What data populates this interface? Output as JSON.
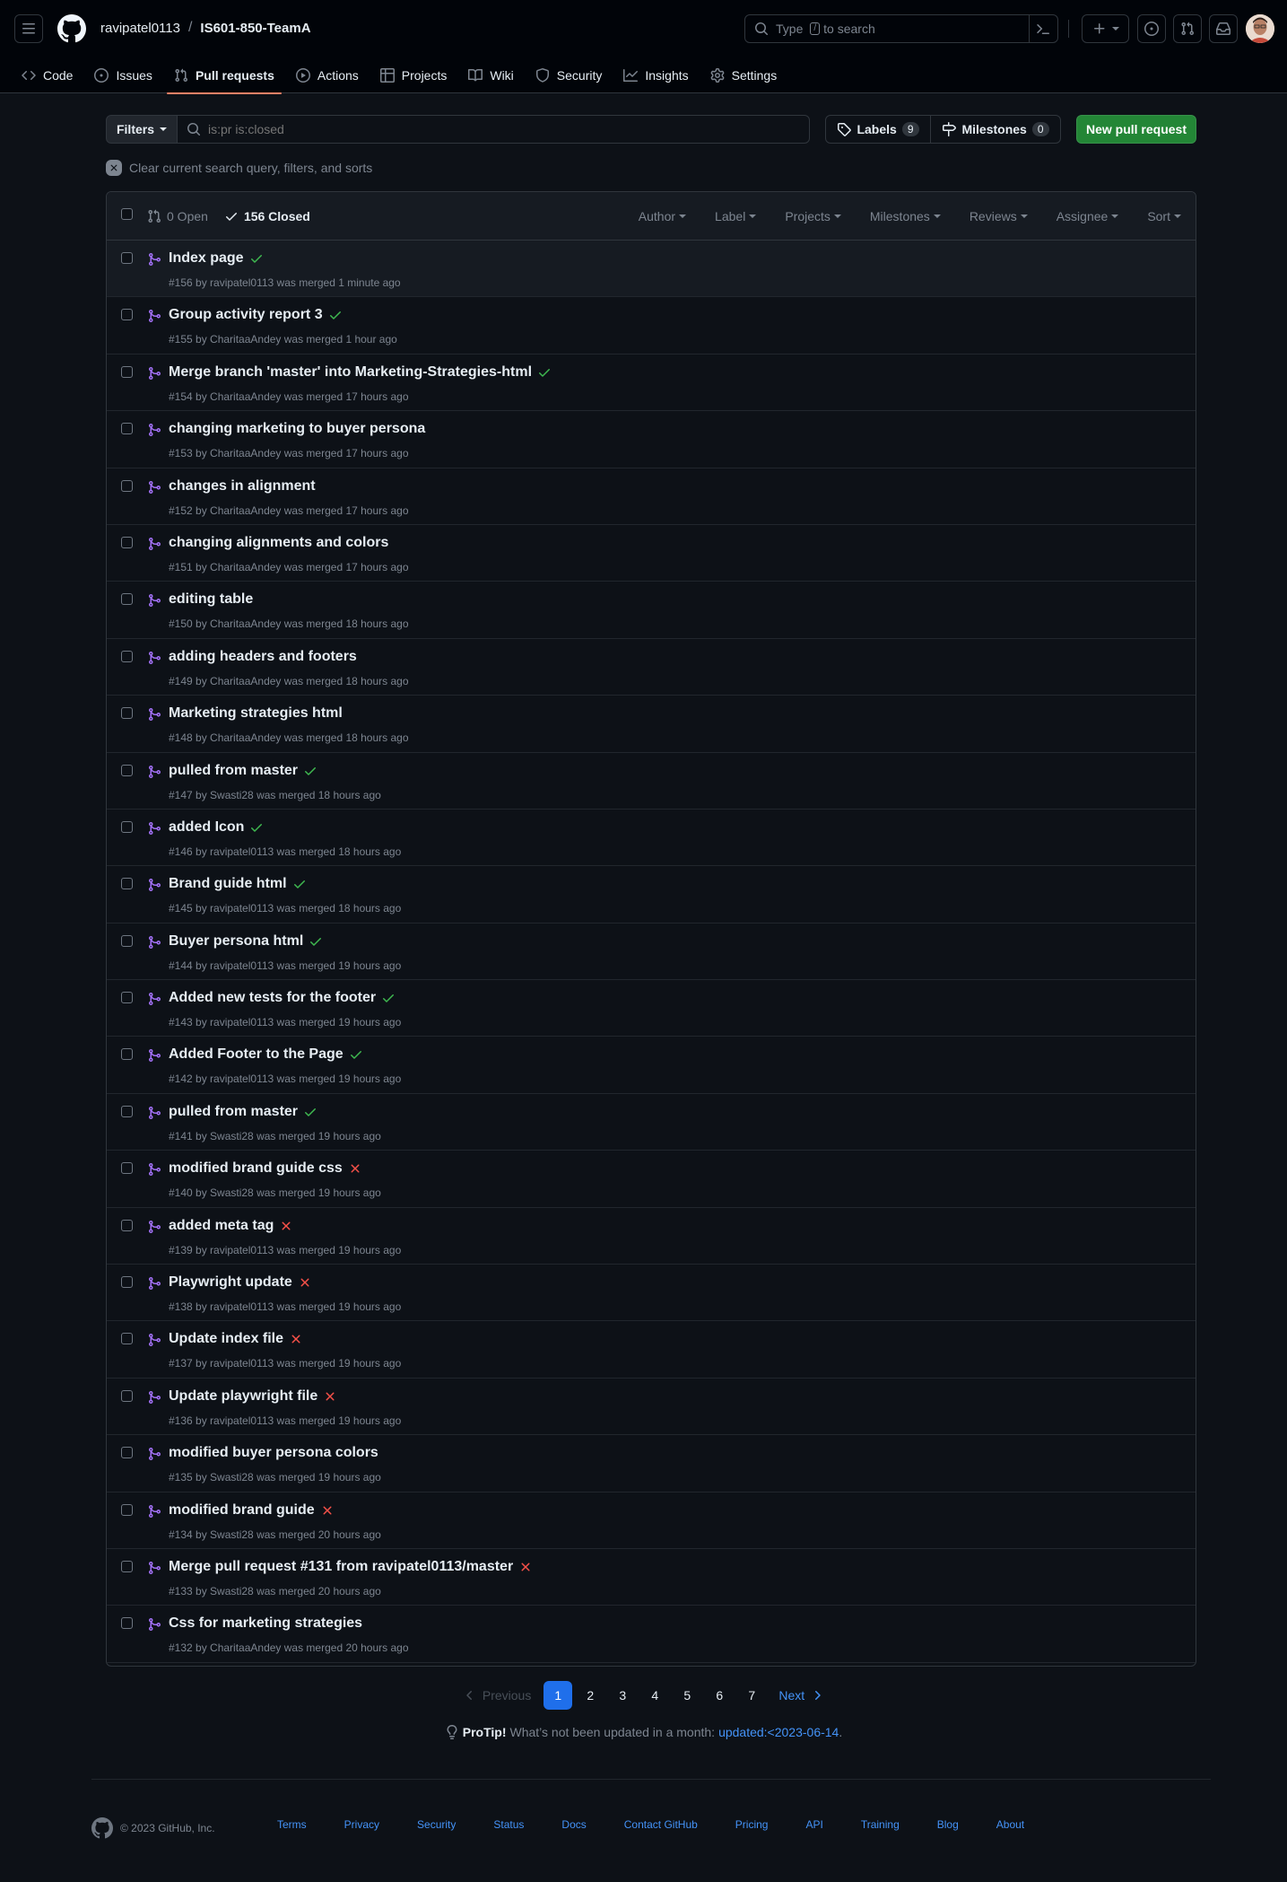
{
  "header": {
    "owner": "ravipatel0113",
    "separator": "/",
    "repo": "IS601-850-TeamA",
    "search_prefix": "Type",
    "search_key": "/",
    "search_suffix": "to search"
  },
  "repo_nav": [
    {
      "label": "Code",
      "icon": "code-icon"
    },
    {
      "label": "Issues",
      "icon": "issue-icon"
    },
    {
      "label": "Pull requests",
      "icon": "pull-request-icon",
      "active": true
    },
    {
      "label": "Actions",
      "icon": "play-icon"
    },
    {
      "label": "Projects",
      "icon": "table-icon"
    },
    {
      "label": "Wiki",
      "icon": "book-icon"
    },
    {
      "label": "Security",
      "icon": "shield-icon"
    },
    {
      "label": "Insights",
      "icon": "graph-icon"
    },
    {
      "label": "Settings",
      "icon": "gear-icon"
    }
  ],
  "subnav": {
    "filters_label": "Filters",
    "search_placeholder": "is:pr is:closed",
    "labels_label": "Labels",
    "labels_count": "9",
    "milestones_label": "Milestones",
    "milestones_count": "0",
    "new_pr_label": "New pull request",
    "clear_label": "Clear current search query, filters, and sorts"
  },
  "list_header": {
    "open_label": "0 Open",
    "closed_label": "156 Closed",
    "filters": [
      "Author",
      "Label",
      "Projects",
      "Milestones",
      "Reviews",
      "Assignee",
      "Sort"
    ]
  },
  "pull_requests": [
    {
      "title": "Index page",
      "meta": "#156 by ravipatel0113 was merged 1 minute ago",
      "status": "success"
    },
    {
      "title": "Group activity report 3",
      "meta": "#155 by CharitaaAndey was merged 1 hour ago",
      "status": "success"
    },
    {
      "title": "Merge branch 'master' into Marketing-Strategies-html",
      "meta": "#154 by CharitaaAndey was merged 17 hours ago",
      "status": "success"
    },
    {
      "title": "changing marketing to buyer persona",
      "meta": "#153 by CharitaaAndey was merged 17 hours ago",
      "status": ""
    },
    {
      "title": "changes in alignment",
      "meta": "#152 by CharitaaAndey was merged 17 hours ago",
      "status": ""
    },
    {
      "title": "changing alignments and colors",
      "meta": "#151 by CharitaaAndey was merged 17 hours ago",
      "status": ""
    },
    {
      "title": "editing table",
      "meta": "#150 by CharitaaAndey was merged 18 hours ago",
      "status": ""
    },
    {
      "title": "adding headers and footers",
      "meta": "#149 by CharitaaAndey was merged 18 hours ago",
      "status": ""
    },
    {
      "title": "Marketing strategies html",
      "meta": "#148 by CharitaaAndey was merged 18 hours ago",
      "status": ""
    },
    {
      "title": "pulled from master",
      "meta": "#147 by Swasti28 was merged 18 hours ago",
      "status": "success"
    },
    {
      "title": "added Icon",
      "meta": "#146 by ravipatel0113 was merged 18 hours ago",
      "status": "success"
    },
    {
      "title": "Brand guide html",
      "meta": "#145 by ravipatel0113 was merged 18 hours ago",
      "status": "success"
    },
    {
      "title": "Buyer persona html",
      "meta": "#144 by ravipatel0113 was merged 19 hours ago",
      "status": "success"
    },
    {
      "title": "Added new tests for the footer",
      "meta": "#143 by ravipatel0113 was merged 19 hours ago",
      "status": "success"
    },
    {
      "title": "Added Footer to the Page",
      "meta": "#142 by ravipatel0113 was merged 19 hours ago",
      "status": "success"
    },
    {
      "title": "pulled from master",
      "meta": "#141 by Swasti28 was merged 19 hours ago",
      "status": "success"
    },
    {
      "title": "modified brand guide css",
      "meta": "#140 by Swasti28 was merged 19 hours ago",
      "status": "failure"
    },
    {
      "title": "added meta tag",
      "meta": "#139 by ravipatel0113 was merged 19 hours ago",
      "status": "failure"
    },
    {
      "title": "Playwright update",
      "meta": "#138 by ravipatel0113 was merged 19 hours ago",
      "status": "failure"
    },
    {
      "title": "Update index file",
      "meta": "#137 by ravipatel0113 was merged 19 hours ago",
      "status": "failure"
    },
    {
      "title": "Update playwright file",
      "meta": "#136 by ravipatel0113 was merged 19 hours ago",
      "status": "failure"
    },
    {
      "title": "modified buyer persona colors",
      "meta": "#135 by Swasti28 was merged 19 hours ago",
      "status": ""
    },
    {
      "title": "modified brand guide",
      "meta": "#134 by Swasti28 was merged 20 hours ago",
      "status": "failure"
    },
    {
      "title": "Merge pull request #131 from ravipatel0113/master",
      "meta": "#133 by Swasti28 was merged 20 hours ago",
      "status": "failure"
    },
    {
      "title": "Css for marketing strategies",
      "meta": "#132 by CharitaaAndey was merged 20 hours ago",
      "status": ""
    }
  ],
  "pagination": {
    "previous": "Previous",
    "pages": [
      "1",
      "2",
      "3",
      "4",
      "5",
      "6",
      "7"
    ],
    "current": "1",
    "next": "Next"
  },
  "protip": {
    "label": "ProTip!",
    "text": "What’s not been updated in a month:",
    "link": "updated:<2023-06-14",
    "end": "."
  },
  "footer": {
    "copyright": "© 2023 GitHub, Inc.",
    "links": [
      "Terms",
      "Privacy",
      "Security",
      "Status",
      "Docs",
      "Contact GitHub",
      "Pricing",
      "API",
      "Training",
      "Blog",
      "About"
    ]
  },
  "colors": {
    "accent": "#1f6feb",
    "merged": "#a371f7",
    "success": "#3fb950",
    "failure": "#f85149",
    "primary_button": "#238636",
    "active_tab_underline": "#f78166"
  }
}
